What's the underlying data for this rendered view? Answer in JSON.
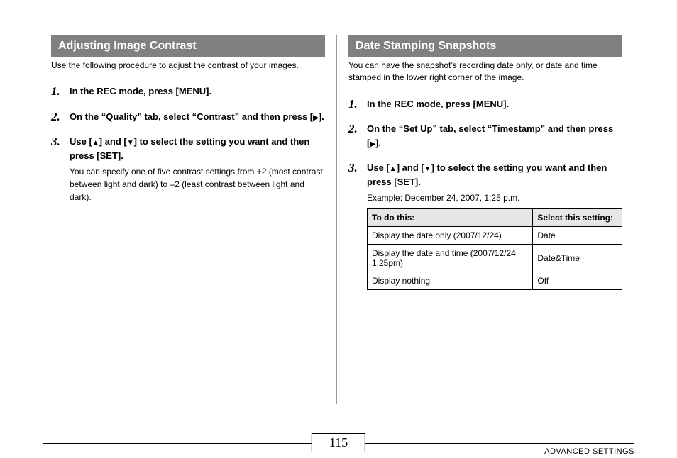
{
  "left": {
    "heading": "Adjusting Image Contrast",
    "intro": "Use the following procedure to adjust the contrast of your images.",
    "steps": [
      {
        "main_pre": "In the REC mode, press [MENU]."
      },
      {
        "main_pre": "On the “Quality” tab, select “Contrast” and then press [",
        "icon": "right",
        "main_post": "]."
      },
      {
        "main_pre": "Use [",
        "icon": "updown",
        "main_mid": "] and [",
        "main_post": "] to select the setting you want and then press [SET].",
        "sub": "You can specify one of five contrast settings from +2 (most contrast between light and dark) to –2 (least contrast between light and dark)."
      }
    ]
  },
  "right": {
    "heading": "Date Stamping Snapshots",
    "intro": "You can have the snapshot’s recording date only, or date and time stamped in the lower right corner of the image.",
    "steps": [
      {
        "main_pre": "In the REC mode, press [MENU]."
      },
      {
        "main_pre": "On the “Set Up” tab, select “Timestamp” and then press [",
        "icon": "right",
        "main_post": "]."
      },
      {
        "main_pre": "Use [",
        "icon": "updown",
        "main_mid": "] and [",
        "main_post": "] to select the setting you want and then press [SET].",
        "sub": "Example: December 24, 2007, 1:25 p.m."
      }
    ],
    "table": {
      "headers": [
        "To do this:",
        "Select this setting:"
      ],
      "rows": [
        [
          "Display the date only (2007/12/24)",
          "Date"
        ],
        [
          "Display the date and time (2007/12/24 1:25pm)",
          "Date&Time"
        ],
        [
          "Display nothing",
          "Off"
        ]
      ]
    }
  },
  "footer": {
    "page_number": "115",
    "section_label": "ADVANCED SETTINGS"
  }
}
